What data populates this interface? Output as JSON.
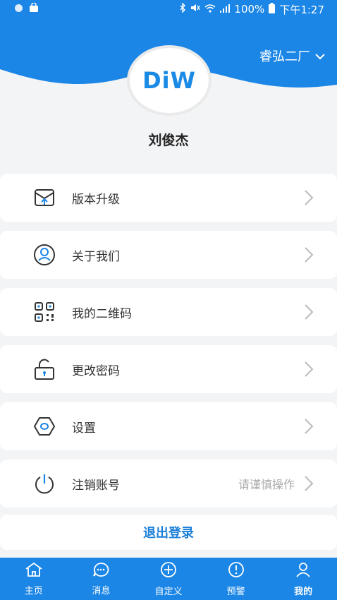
{
  "status_bar": {
    "battery": "100%",
    "time": "下午1:27"
  },
  "header": {
    "factory": "睿弘二厂",
    "logo": "DiW",
    "username": "刘俊杰"
  },
  "menu": [
    {
      "label": "版本升级",
      "icon": "upgrade-icon"
    },
    {
      "label": "关于我们",
      "icon": "user-icon"
    },
    {
      "label": "我的二维码",
      "icon": "qrcode-icon"
    },
    {
      "label": "更改密码",
      "icon": "lock-icon"
    },
    {
      "label": "设置",
      "icon": "settings-icon"
    },
    {
      "label": "注销账号",
      "icon": "power-icon",
      "hint": "请谨慎操作"
    }
  ],
  "logout_label": "退出登录",
  "tabs": [
    {
      "label": "主页",
      "icon": "home-icon"
    },
    {
      "label": "消息",
      "icon": "message-icon"
    },
    {
      "label": "自定义",
      "icon": "plus-circle-icon"
    },
    {
      "label": "预警",
      "icon": "alert-icon"
    },
    {
      "label": "我的",
      "icon": "profile-icon",
      "active": true
    }
  ],
  "colors": {
    "primary": "#1b86e6",
    "logout_text": "#1a7fd8",
    "background": "#f3f4f6"
  }
}
